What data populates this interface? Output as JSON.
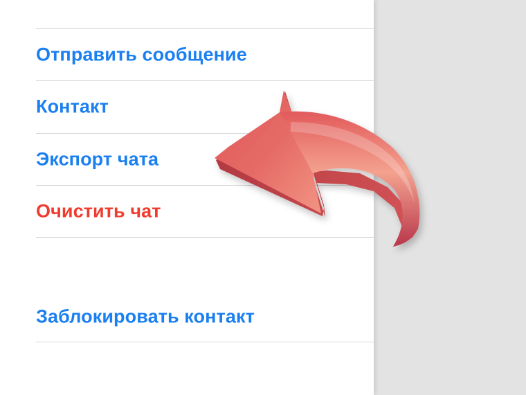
{
  "menu": {
    "items": [
      {
        "label": "Отправить сообщение",
        "color": "#1a7ff0",
        "name": "send-message-item"
      },
      {
        "label": "Контакт",
        "color": "#1a7ff0",
        "name": "contact-item"
      },
      {
        "label": "Экспорт чата",
        "color": "#1a7ff0",
        "name": "export-chat-item"
      },
      {
        "label": "Очистить чат",
        "color": "#f03c2e",
        "name": "clear-chat-item"
      }
    ],
    "block": {
      "label": "Заблокировать контакт",
      "color": "#1a7ff0"
    }
  },
  "annotation": {
    "icon": "curved-arrow-icon",
    "color": "#e25f5f"
  }
}
